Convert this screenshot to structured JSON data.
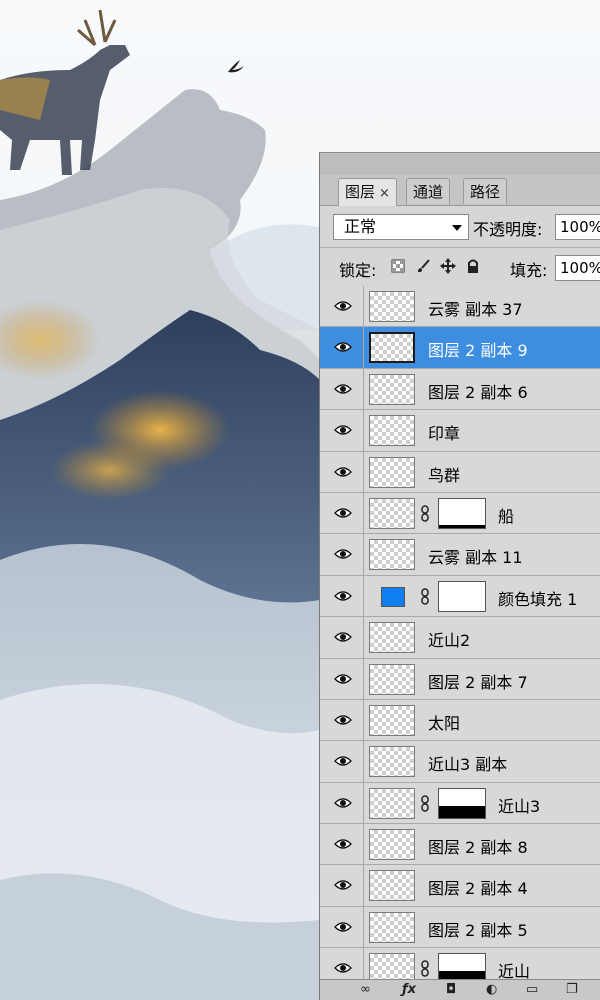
{
  "panel": {
    "tabs": [
      {
        "label": "图层",
        "close": "×"
      },
      {
        "label": "通道"
      },
      {
        "label": "路径"
      }
    ],
    "blend_mode": "正常",
    "opacity_label": "不透明度:",
    "opacity_value": "100%",
    "lock_label": "锁定:",
    "fill_label": "填充:",
    "fill_value": "100%"
  },
  "layers": [
    {
      "name": "云雾 副本 37"
    },
    {
      "name": "图层 2 副本 9"
    },
    {
      "name": "图层 2 副本 6"
    },
    {
      "name": "印章"
    },
    {
      "name": "鸟群"
    },
    {
      "name": "船"
    },
    {
      "name": "云雾 副本 11"
    },
    {
      "name": "颜色填充 1"
    },
    {
      "name": "近山2"
    },
    {
      "name": "图层 2 副本 7"
    },
    {
      "name": "太阳"
    },
    {
      "name": "近山3 副本"
    },
    {
      "name": "近山3"
    },
    {
      "name": "图层 2 副本 8"
    },
    {
      "name": "图层 2 副本 4"
    },
    {
      "name": "图层 2 副本 5"
    },
    {
      "name": "近山"
    }
  ],
  "colors": {
    "selection": "#3d8ee0",
    "fill_swatch": "#0f7ef0"
  },
  "footer_icons": [
    "link-icon",
    "fx-icon",
    "mask-icon",
    "adjustment-icon",
    "folder-icon",
    "new-layer-icon"
  ]
}
